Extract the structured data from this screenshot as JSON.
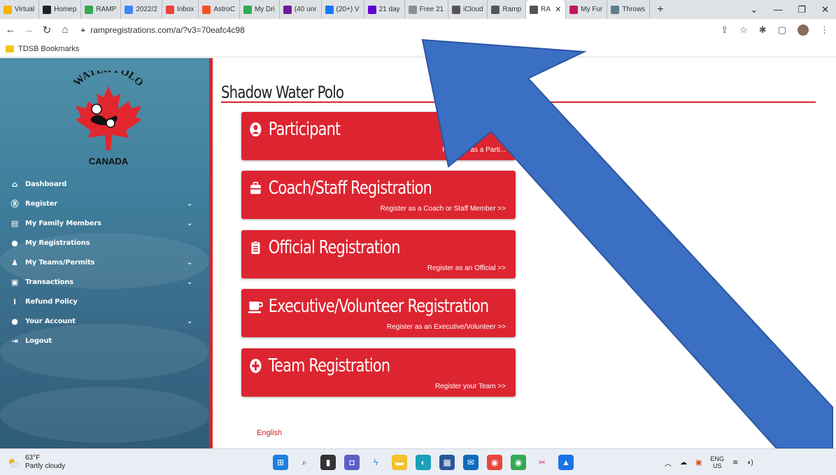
{
  "browser": {
    "tabs": [
      {
        "label": "Virtual",
        "color": "#f4b400"
      },
      {
        "label": "Homep",
        "color": "#222222"
      },
      {
        "label": "RAMP",
        "color": "#34a853"
      },
      {
        "label": "2022/2",
        "color": "#4285f4"
      },
      {
        "label": "Inbox",
        "color": "#ea4335"
      },
      {
        "label": "AstroC",
        "color": "#f4511e"
      },
      {
        "label": "My Dri",
        "color": "#34a853"
      },
      {
        "label": "(40 unr",
        "color": "#6a1b9a"
      },
      {
        "label": "(20+) V",
        "color": "#1877f2"
      },
      {
        "label": "21 day",
        "color": "#6001d2"
      },
      {
        "label": "Free 21",
        "color": "#8e8e8e"
      },
      {
        "label": "iCloud",
        "color": "#555555"
      },
      {
        "label": "Ramp",
        "color": "#555555"
      },
      {
        "label": "RA",
        "color": "#555555",
        "active": true
      },
      {
        "label": "My Fur",
        "color": "#c2185b"
      },
      {
        "label": "Throws",
        "color": "#607d8b"
      }
    ],
    "url": "rampregistrations.com/a/?v3=70eafc4c98",
    "bookmark": "TDSB Bookmarks"
  },
  "sidebar": {
    "logo_text_top": "WATER POLO",
    "logo_text_bottom": "CANADA",
    "items": [
      {
        "label": "Dashboard",
        "icon": "home-icon",
        "glyph": "⌂",
        "chevron": false
      },
      {
        "label": "Register",
        "icon": "register-icon",
        "glyph": "Ⓡ",
        "chevron": true
      },
      {
        "label": "My Family Members",
        "icon": "id-card-icon",
        "glyph": "▤",
        "chevron": true
      },
      {
        "label": "My Registrations",
        "icon": "user-circle-icon",
        "glyph": "●",
        "chevron": false
      },
      {
        "label": "My Teams/Permits",
        "icon": "users-icon",
        "glyph": "♟",
        "chevron": true
      },
      {
        "label": "Transactions",
        "icon": "money-icon",
        "glyph": "▣",
        "chevron": true
      },
      {
        "label": "Refund Policy",
        "icon": "info-icon",
        "glyph": "i",
        "chevron": false
      },
      {
        "label": "Your Account",
        "icon": "account-icon",
        "glyph": "●",
        "chevron": true
      },
      {
        "label": "Logout",
        "icon": "logout-icon",
        "glyph": "⇥",
        "chevron": false
      }
    ]
  },
  "main": {
    "title": "Shadow Water Polo",
    "cards": [
      {
        "title": "Participant",
        "subtitle": "Register as a Parti...",
        "icon": "user-circle-icon"
      },
      {
        "title": "Coach/Staff Registration",
        "subtitle": "Register as a Coach or Staff Member >>",
        "icon": "briefcase-icon"
      },
      {
        "title": "Official Registration",
        "subtitle": "Register as an Official >>",
        "icon": "clipboard-icon"
      },
      {
        "title": "Executive/Volunteer Registration",
        "subtitle": "Register as an Executive/Volunteer >>",
        "icon": "coffee-icon"
      },
      {
        "title": "Team Registration",
        "subtitle": "Register your Team >>",
        "icon": "plus-circle-icon"
      }
    ],
    "language": "English"
  },
  "taskbar": {
    "temperature": "63°F",
    "weather": "Partly cloudy",
    "lang_top": "ENG",
    "lang_bottom": "US"
  },
  "colors": {
    "brand_red": "#dd2531",
    "sidebar_blue": "#3f7f9c",
    "arrow_blue": "#3a6fc4"
  }
}
